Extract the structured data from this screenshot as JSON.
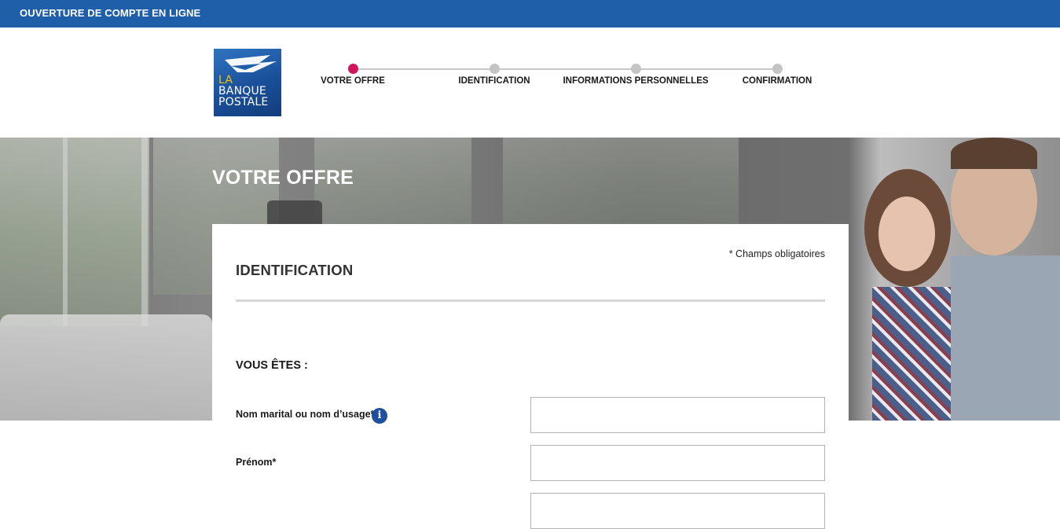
{
  "topbar": {
    "title": "OUVERTURE DE COMPTE EN LIGNE"
  },
  "logo": {
    "line1": "LA",
    "line2": "BANQUE",
    "line3": "POSTALE"
  },
  "stepper": {
    "steps": [
      {
        "label": "VOTRE OFFRE",
        "active": true
      },
      {
        "label": "IDENTIFICATION",
        "active": false
      },
      {
        "label": "INFORMATIONS PERSONNELLES",
        "active": false
      },
      {
        "label": "CONFIRMATION",
        "active": false
      }
    ],
    "active_color": "#d4145a",
    "inactive_color": "#c4c4c4"
  },
  "hero": {
    "title": "VOTRE OFFRE"
  },
  "form": {
    "required_note": "* Champs obligatoires",
    "title": "IDENTIFICATION",
    "section_title": "VOUS ÊTES :",
    "fields": [
      {
        "label": "Nom marital ou nom d’usage*",
        "value": "",
        "has_info": true
      },
      {
        "label": "Prénom*",
        "value": "",
        "has_info": false
      }
    ],
    "info_icon_glyph": "i"
  },
  "colors": {
    "brand_blue": "#1f5ea8",
    "accent_pink": "#d4145a",
    "logo_yellow": "#f5c400"
  }
}
